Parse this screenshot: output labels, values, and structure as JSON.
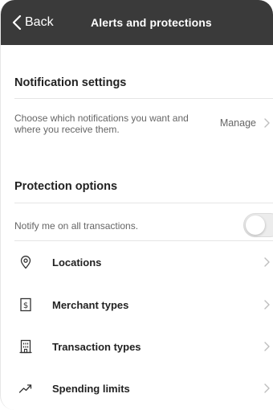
{
  "nav": {
    "back_label": "Back",
    "title": "Alerts and protections"
  },
  "notifications": {
    "heading": "Notification settings",
    "description": "Choose which notifications you want and where you receive them.",
    "manage_label": "Manage"
  },
  "protection": {
    "heading": "Protection options",
    "notify_label": "Notify me on all transactions.",
    "notify_enabled": false,
    "items": [
      {
        "label": "Locations",
        "icon": "location-pin-icon"
      },
      {
        "label": "Merchant types",
        "icon": "receipt-dollar-icon"
      },
      {
        "label": "Transaction types",
        "icon": "building-icon"
      },
      {
        "label": "Spending limits",
        "icon": "trend-up-icon"
      }
    ]
  },
  "colors": {
    "nav_bg": "#3a3a3a",
    "text": "#222222",
    "muted": "#666666",
    "divider": "#e5e5e5"
  }
}
